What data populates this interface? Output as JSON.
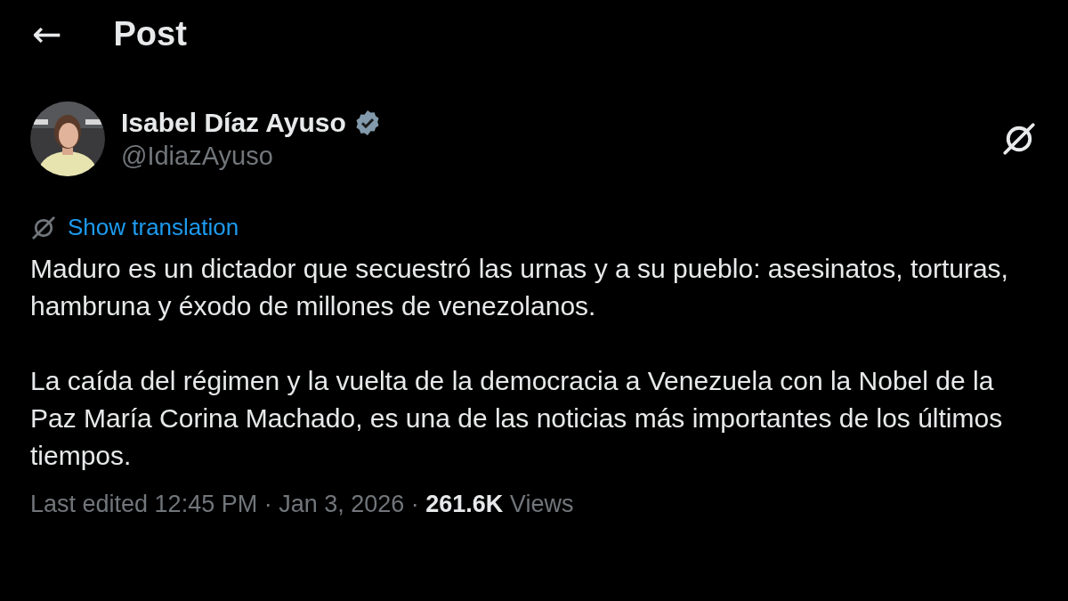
{
  "header": {
    "back": "←",
    "title": "Post"
  },
  "author": {
    "kind": "picture",
    "name": "Isabel Díaz Ayuso",
    "verified": true,
    "handle": "@IdiazAyuso"
  },
  "translation_link": "Show translation",
  "paragraphs": [
    "Maduro es un dictador que secuestró las urnas y a su pueblo: asesinatos, torturas, hambruna y éxodo de millones de venezolanos.",
    "La caída del régimen y la vuelta de la democracia a Venezuela con la Nobel de la Paz María Corina Machado, es una de las noticias más importantes de los últimos tiempos."
  ],
  "meta": "Last edited 12:45 PM · Jan 3, 2026 · **261.6K** Views"
}
